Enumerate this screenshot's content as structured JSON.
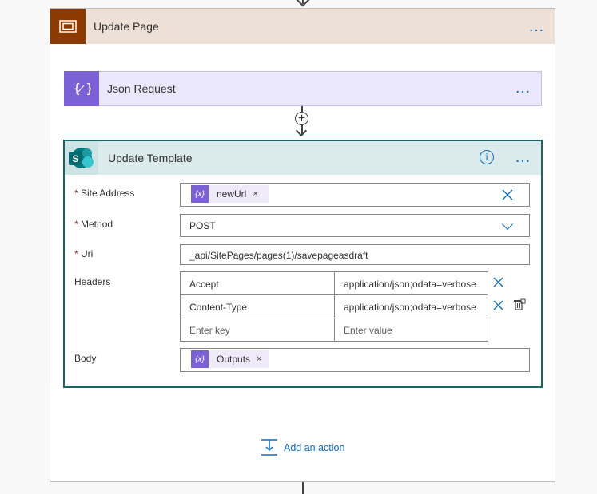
{
  "scope": {
    "title": "Update Page",
    "more_label": "…"
  },
  "json_request": {
    "title": "Json Request",
    "more_label": "…"
  },
  "insert_step": {
    "symbol": "+"
  },
  "update_template": {
    "title": "Update Template",
    "info_symbol": "i",
    "more_label": "…",
    "fields": {
      "site_address": {
        "label": "Site Address",
        "required_mark": "*",
        "token_label": "newUrl",
        "token_icon": "{x}",
        "token_remove": "×"
      },
      "method": {
        "label": "Method",
        "required_mark": "*",
        "value": "POST"
      },
      "uri": {
        "label": "Uri",
        "required_mark": "*",
        "value": "_api/SitePages/pages(1)/savepageasdraft"
      },
      "headers": {
        "label": "Headers",
        "rows": [
          {
            "key": "Accept",
            "value": "application/json;odata=verbose"
          },
          {
            "key": "Content-Type",
            "value": "application/json;odata=verbose"
          }
        ],
        "key_placeholder": "Enter key",
        "value_placeholder": "Enter value"
      },
      "body": {
        "label": "Body",
        "token_label": "Outputs",
        "token_icon": "{x}",
        "token_remove": "×"
      }
    }
  },
  "add_action": {
    "label": "Add an action"
  },
  "colors": {
    "scope_accent": "#8c3900",
    "scope_header_bg": "#ede0d6",
    "json_accent": "#7b61d5",
    "json_bg": "#ebe7fd",
    "sharepoint_accent": "#1b6467",
    "link_blue": "#0f6cbd"
  },
  "icons": {
    "scope": "scope-icon",
    "json": "variable-icon",
    "sharepoint": "sharepoint-icon",
    "info": "info-icon",
    "more": "more-icon",
    "clear": "close-icon",
    "delete": "trash-icon",
    "dropdown": "chevron-down-icon",
    "add_action": "add-action-icon"
  }
}
